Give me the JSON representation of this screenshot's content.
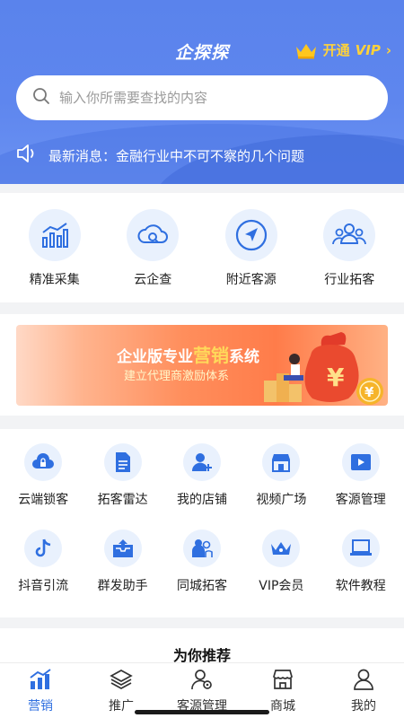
{
  "header": {
    "app_title": "企探探",
    "vip_open": "开通",
    "vip_label": "VIP",
    "vip_chevron": "›"
  },
  "search": {
    "placeholder": "输入你所需要查找的内容"
  },
  "news": {
    "text": "最新消息：金融行业中不可不察的几个问题"
  },
  "features": [
    {
      "label": "精准采集",
      "icon": "bar-chart-icon"
    },
    {
      "label": "云企查",
      "icon": "cloud-search-icon"
    },
    {
      "label": "附近客源",
      "icon": "location-arrow-icon"
    },
    {
      "label": "行业拓客",
      "icon": "user-group-icon"
    }
  ],
  "banner": {
    "title_prefix": "企业版专业",
    "title_highlight": "营销",
    "title_suffix": "系统",
    "subtitle": "建立代理商激励体系",
    "yen": "¥"
  },
  "tools": [
    {
      "label": "云端锁客",
      "icon": "cloud-lock-icon"
    },
    {
      "label": "拓客雷达",
      "icon": "document-icon"
    },
    {
      "label": "我的店铺",
      "icon": "add-user-icon"
    },
    {
      "label": "视频广场",
      "icon": "store-icon"
    },
    {
      "label": "客源管理",
      "icon": "play-video-icon"
    },
    {
      "label": "抖音引流",
      "icon": "tiktok-icon"
    },
    {
      "label": "群发助手",
      "icon": "send-box-icon"
    },
    {
      "label": "同城拓客",
      "icon": "people-icon"
    },
    {
      "label": "VIP会员",
      "icon": "crown-icon"
    },
    {
      "label": "软件教程",
      "icon": "laptop-icon"
    }
  ],
  "recommend": {
    "title": "为你推荐"
  },
  "tabs": [
    {
      "label": "营销",
      "icon": "marketing-icon",
      "active": true
    },
    {
      "label": "推广",
      "icon": "layers-icon",
      "active": false
    },
    {
      "label": "客源管理",
      "icon": "user-settings-icon",
      "active": false
    },
    {
      "label": "商城",
      "icon": "shop-icon",
      "active": false
    },
    {
      "label": "我的",
      "icon": "profile-icon",
      "active": false
    }
  ],
  "colors": {
    "primary": "#5a83ec",
    "accent": "#2f6fe0",
    "vip_gold": "#ffd23a"
  }
}
